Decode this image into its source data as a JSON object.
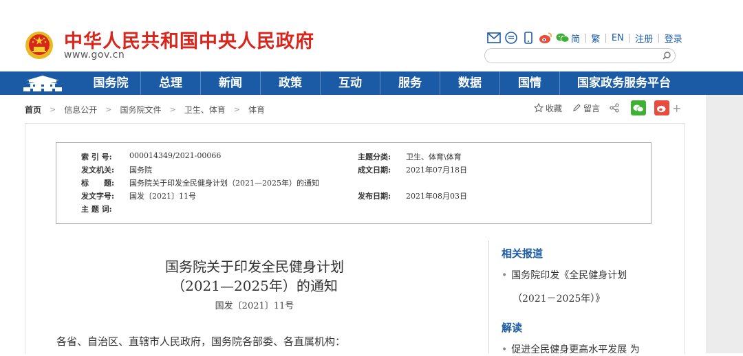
{
  "header": {
    "title": "中华人民共和国中央人民政府",
    "url": "www.gov.cn",
    "icons": [
      "mail-icon",
      "chat-icon",
      "mobile-icon",
      "weibo-icon",
      "wechat-icon"
    ],
    "languages": [
      "简",
      "繁",
      "EN",
      "注册",
      "登录"
    ],
    "search_placeholder": ""
  },
  "nav": {
    "items": [
      "国务院",
      "总理",
      "新闻",
      "政策",
      "互动",
      "服务",
      "数据",
      "国情",
      "国家政务服务平台"
    ]
  },
  "breadcrumb": [
    "首页",
    "信息公开",
    "国务院文件",
    "卫生、体育",
    "体育"
  ],
  "share": {
    "favorite": "收藏",
    "comment": "留言"
  },
  "meta": {
    "index_label": "索 引 号:",
    "index_value": "000014349/2021-00066",
    "topic_label": "主题分类:",
    "topic_value": "卫生、体育\\体育",
    "issuer_label": "发文机关:",
    "issuer_value": "国务院",
    "date_written_label": "成文日期:",
    "date_written_value": "2021年07月18日",
    "title_label": "标　　题:",
    "title_value": "国务院关于印发全民健身计划（2021—2025年）的通知",
    "docno_label": "发文字号:",
    "docno_value": "国发〔2021〕11号",
    "pub_label": "发布日期:",
    "pub_value": "2021年08月03日",
    "keywords_label": "主 题 词:"
  },
  "doc": {
    "title_line1": "国务院关于印发全民健身计划",
    "title_line2": "（2021—2025年）的通知",
    "number": "国发〔2021〕11号",
    "salutation": "各省、自治区、直辖市人民政府，国务院各部委、各直属机构："
  },
  "sidebar": {
    "related_heading": "相关报道",
    "related_item_line1": "国务院印发《全民健身计划",
    "related_item_line2": "（2021－2025年）》",
    "reading_heading": "解读",
    "reading_item": "促进全民健身更高水平发展 为"
  },
  "colors": {
    "brand_red": "#d9261c",
    "nav_blue": "#1b5aa5",
    "wechat_green": "#3eb135",
    "weibo_red": "#e94b3c"
  }
}
